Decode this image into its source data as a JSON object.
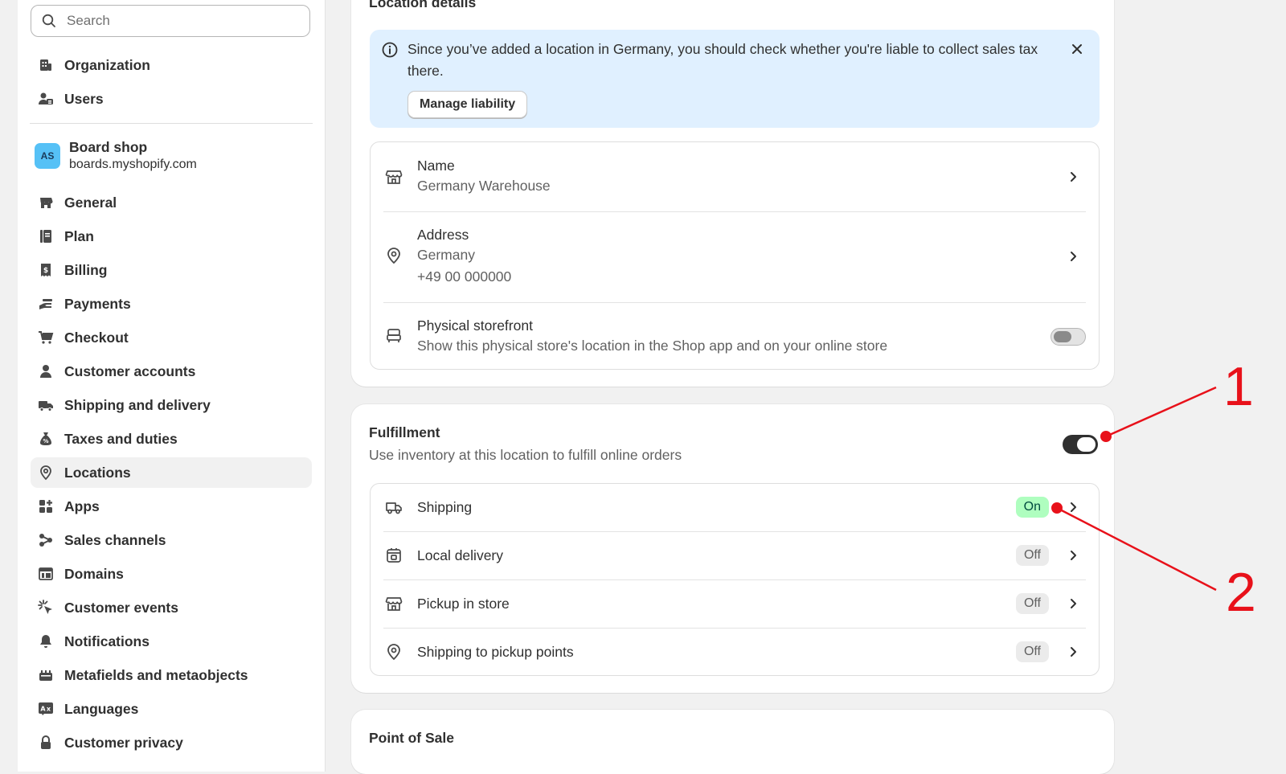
{
  "sidebar": {
    "search": {
      "placeholder": "Search",
      "value": ""
    },
    "top_items": [
      {
        "label": "Organization",
        "icon": "organization-icon"
      },
      {
        "label": "Users",
        "icon": "users-icon"
      }
    ],
    "store": {
      "avatar_initials": "AS",
      "name": "Board shop",
      "url": "boards.myshopify.com"
    },
    "items": [
      {
        "label": "General",
        "icon": "store-icon"
      },
      {
        "label": "Plan",
        "icon": "plan-icon"
      },
      {
        "label": "Billing",
        "icon": "billing-icon"
      },
      {
        "label": "Payments",
        "icon": "payments-icon"
      },
      {
        "label": "Checkout",
        "icon": "cart-icon"
      },
      {
        "label": "Customer accounts",
        "icon": "person-icon"
      },
      {
        "label": "Shipping and delivery",
        "icon": "truck-icon"
      },
      {
        "label": "Taxes and duties",
        "icon": "tax-icon"
      },
      {
        "label": "Locations",
        "icon": "location-icon",
        "active": true
      },
      {
        "label": "Apps",
        "icon": "apps-icon"
      },
      {
        "label": "Sales channels",
        "icon": "sales-channels-icon"
      },
      {
        "label": "Domains",
        "icon": "domains-icon"
      },
      {
        "label": "Customer events",
        "icon": "cursor-icon"
      },
      {
        "label": "Notifications",
        "icon": "bell-icon"
      },
      {
        "label": "Metafields and metaobjects",
        "icon": "metafields-icon"
      },
      {
        "label": "Languages",
        "icon": "languages-icon"
      },
      {
        "label": "Customer privacy",
        "icon": "lock-icon"
      }
    ]
  },
  "location_details": {
    "title": "Location details",
    "banner": {
      "message": "Since you’ve added a location in Germany, you should check whether you're liable to collect sales tax there.",
      "button_label": "Manage liability"
    },
    "name": {
      "label": "Name",
      "value": "Germany Warehouse"
    },
    "address": {
      "label": "Address",
      "line1": "Germany",
      "line2": "+49 00 000000"
    },
    "storefront": {
      "label": "Physical storefront",
      "description": "Show this physical store's location in the Shop app and on your online store",
      "enabled": false
    }
  },
  "fulfillment": {
    "title": "Fulfillment",
    "description": "Use inventory at this location to fulfill online orders",
    "enabled": true,
    "rows": [
      {
        "label": "Shipping",
        "status": "On",
        "icon": "truck-icon"
      },
      {
        "label": "Local delivery",
        "status": "Off",
        "icon": "delivery-box-icon"
      },
      {
        "label": "Pickup in store",
        "status": "Off",
        "icon": "store-icon"
      },
      {
        "label": "Shipping to pickup points",
        "status": "Off",
        "icon": "location-pin-icon"
      }
    ]
  },
  "point_of_sale": {
    "title": "Point of Sale"
  },
  "annotations": [
    {
      "label": "1"
    },
    {
      "label": "2"
    }
  ],
  "colors": {
    "annotation": "#e8111a",
    "banner": "#e0f0ff",
    "badge_on": "#affebf",
    "toggle_on": "#303030"
  }
}
